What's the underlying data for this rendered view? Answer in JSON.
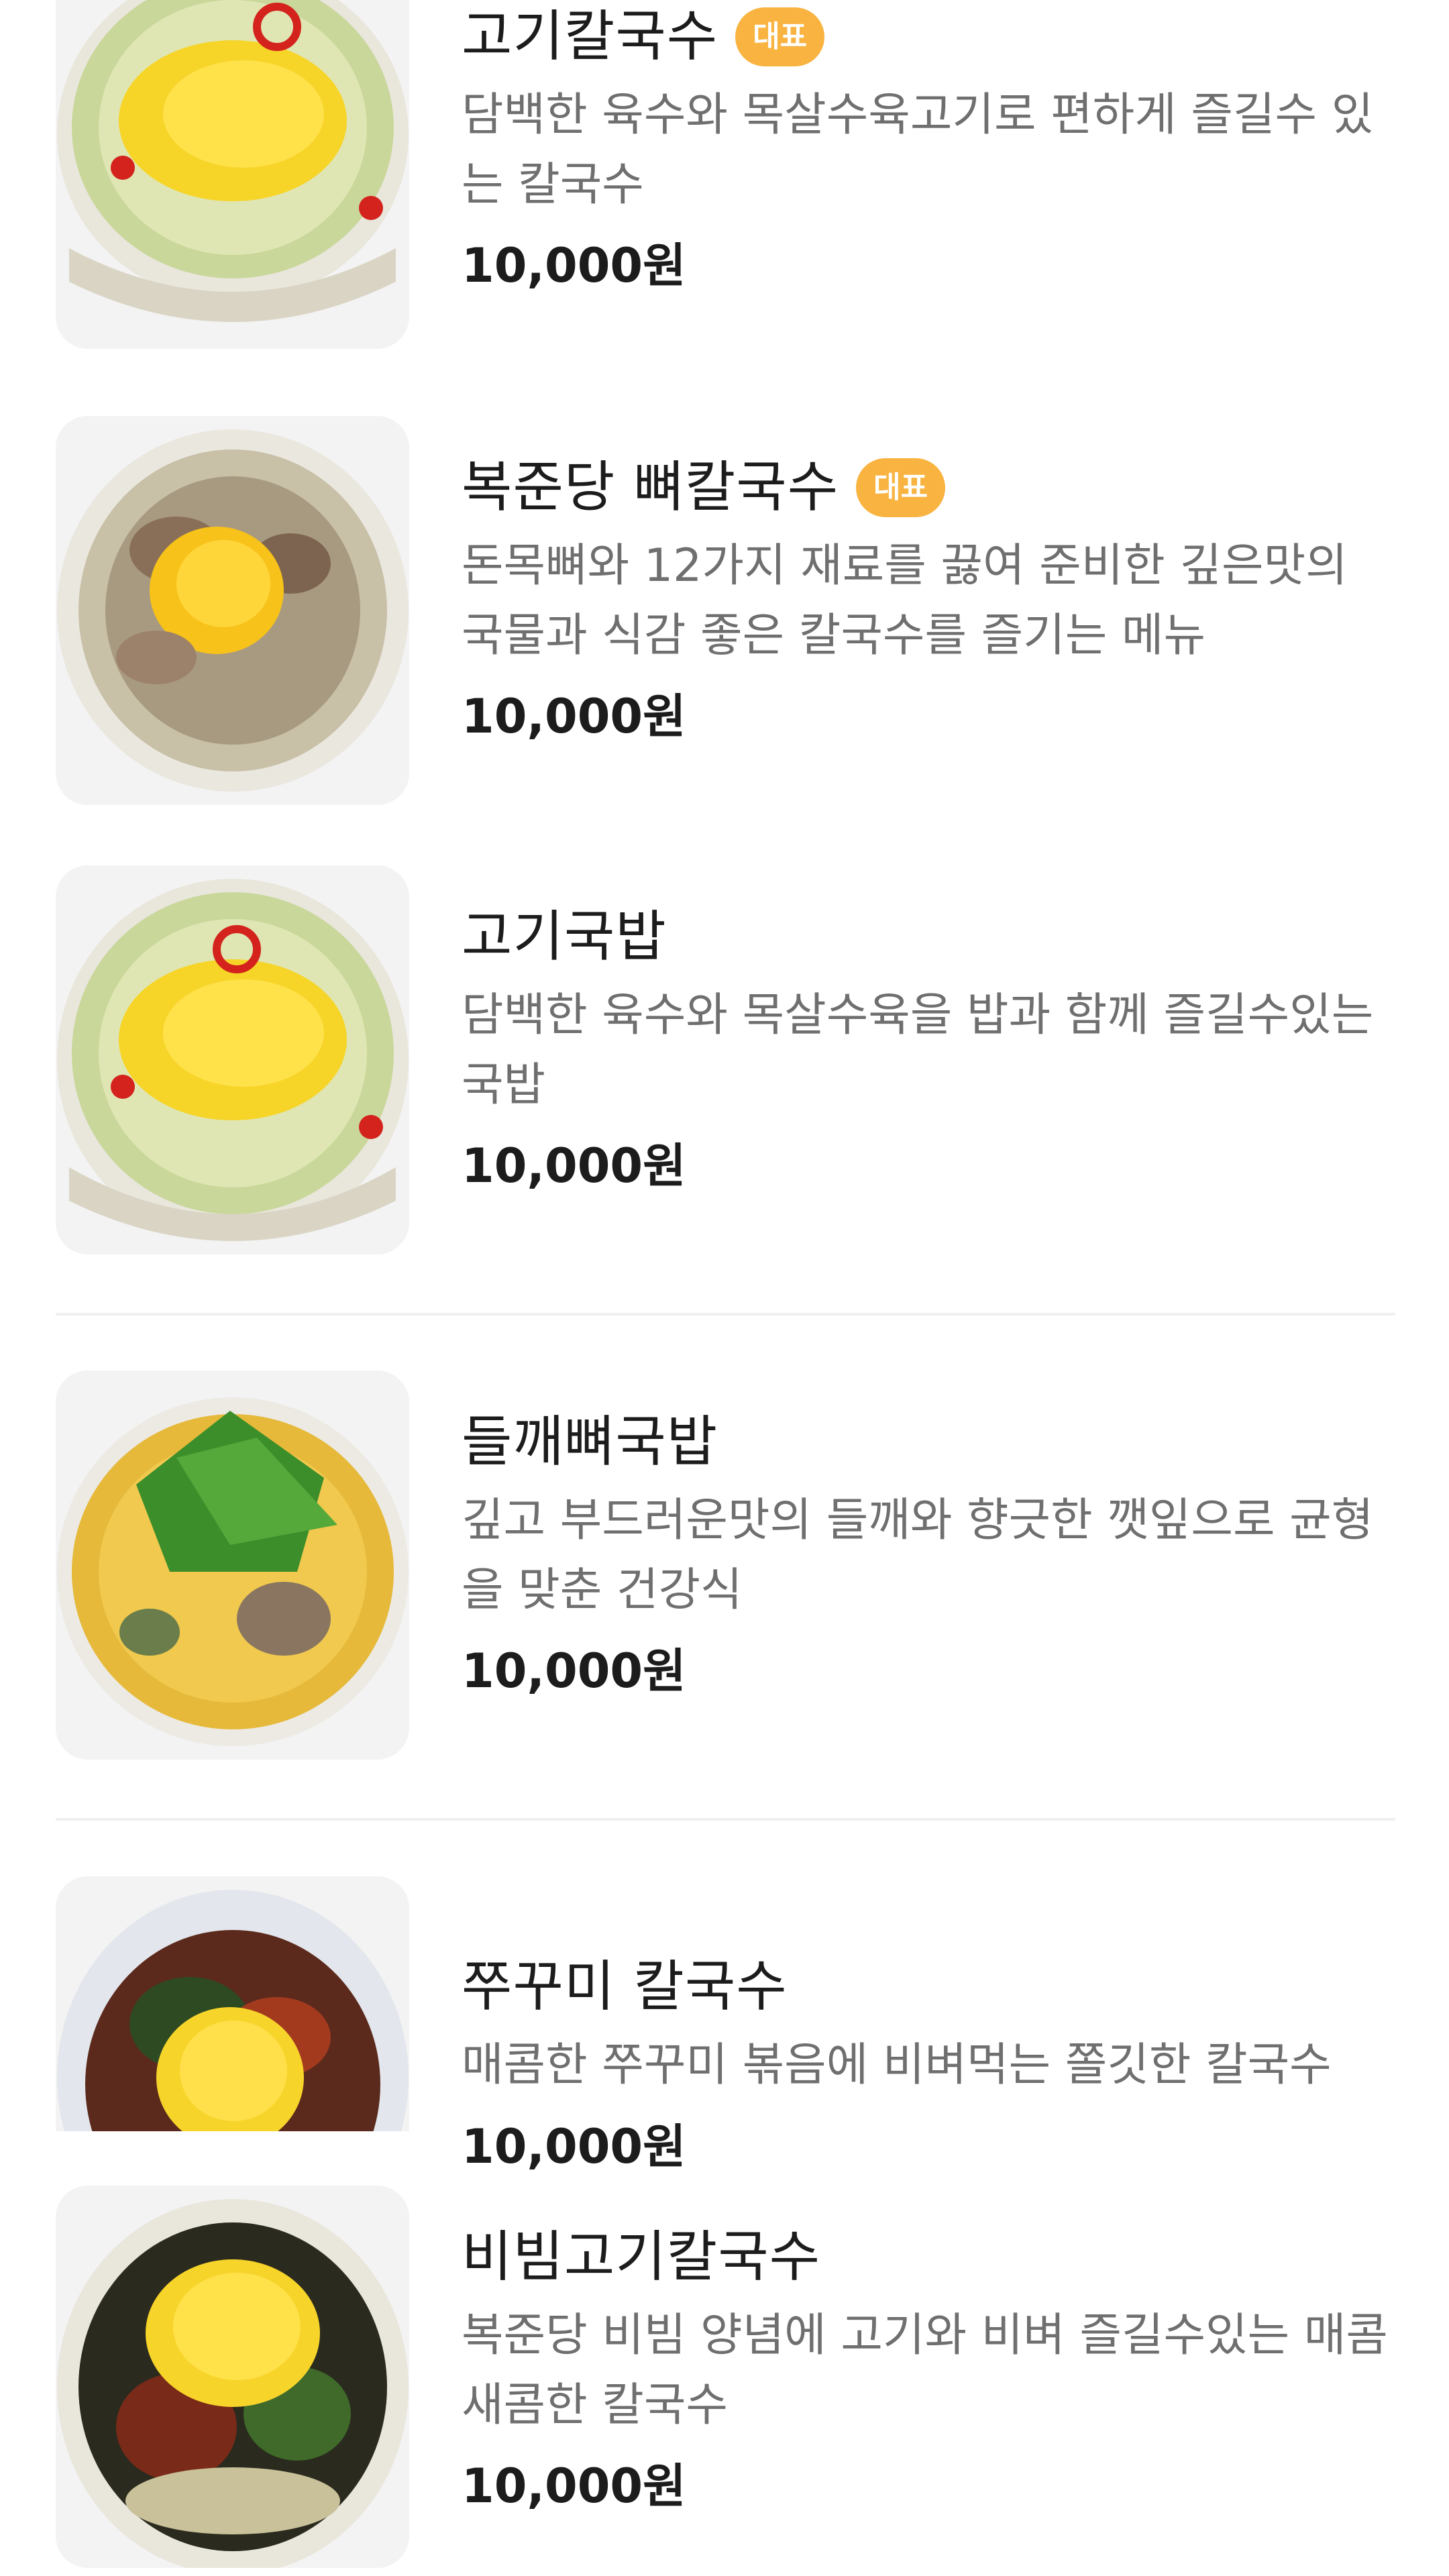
{
  "menu": {
    "badge_label": "대표",
    "items": [
      {
        "name": "고기칼국수",
        "badge": "대표",
        "description": "담백한 육수와 목살수육고기로 편하게 즐길수 있는 칼국수",
        "price": "10,000원",
        "photo_icon": "noodle-soup-egg-icon"
      },
      {
        "name": "복준당 뼈칼국수",
        "badge": "대표",
        "description": "돈목뼈와 12가지 재료를 끓여 준비한 깊은맛의 국물과 식감 좋은 칼국수를 즐기는 메뉴",
        "price": "10,000원",
        "photo_icon": "bone-noodle-soup-icon"
      },
      {
        "name": "고기국밥",
        "badge": "",
        "description": "담백한 육수와 목살수육을 밥과 함께 즐길수있는 국밥",
        "price": "10,000원",
        "photo_icon": "rice-soup-egg-icon"
      },
      {
        "name": "들깨뼈국밥",
        "badge": "",
        "description": "깊고 부드러운맛의 들깨와 향긋한 깻잎으로 균형을 맞춘 건강식",
        "price": "10,000원",
        "photo_icon": "perilla-soup-icon"
      },
      {
        "name": "쭈꾸미 칼국수",
        "badge": "",
        "description": "매콤한 쭈꾸미 볶음에 비벼먹는 쫄깃한 칼국수",
        "price": "10,000원",
        "photo_icon": "spicy-webfoot-noodle-icon"
      },
      {
        "name": "비빔고기칼국수",
        "badge": "",
        "description": "복준당 비빔 양념에 고기와 비벼 즐길수있는 매콤 새콤한 칼국수",
        "price": "10,000원",
        "photo_icon": "bibim-noodle-icon"
      }
    ]
  },
  "colors": {
    "badge_bg": "#f9b341",
    "text_primary": "#1c1c1c",
    "text_secondary": "#6f6f6f",
    "divider": "#f0f0f0"
  }
}
